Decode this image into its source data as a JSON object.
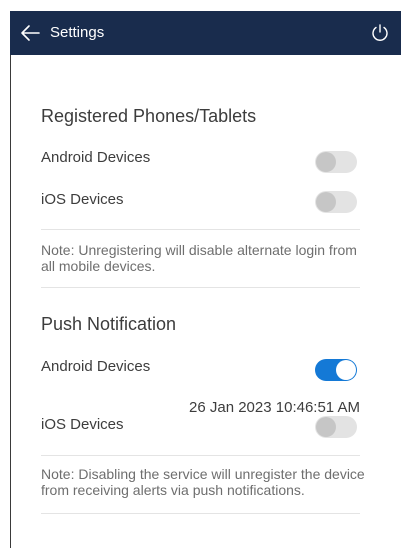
{
  "header": {
    "title": "Settings",
    "back_icon": "arrow-left-icon",
    "power_icon": "power-icon",
    "background": "#192c4d"
  },
  "registered_section": {
    "title": "Registered Phones/Tablets",
    "rows": [
      {
        "label": "Android Devices",
        "enabled": false
      },
      {
        "label": "iOS Devices",
        "enabled": false
      }
    ],
    "note": "Note: Unregistering will disable alternate login from all mobile devices."
  },
  "push_section": {
    "title": "Push Notification",
    "rows": [
      {
        "label": "Android Devices",
        "enabled": true
      },
      {
        "label": "iOS Devices",
        "enabled": false,
        "timestamp": "26 Jan 2023 10:46:51 AM"
      }
    ],
    "note": "Note: Disabling the service will unregister the device from receiving alerts via push notifications."
  },
  "colors": {
    "toggle_on": "#1479d6",
    "toggle_off_track": "#e3e3e3",
    "toggle_off_knob": "#c6c6c6"
  }
}
